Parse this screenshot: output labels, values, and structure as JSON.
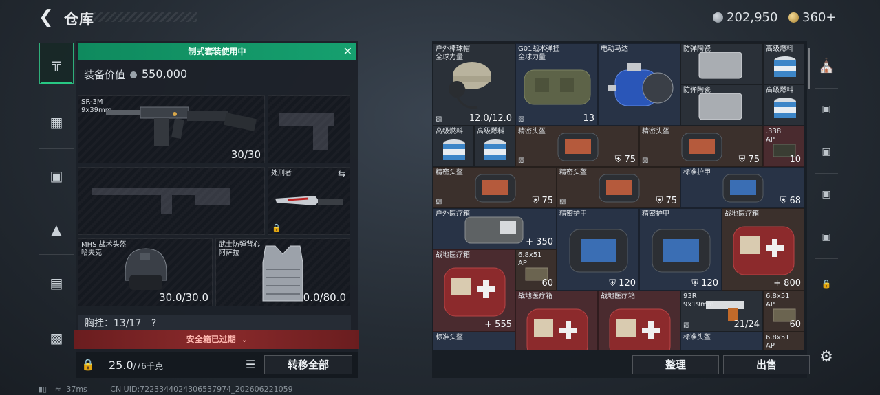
{
  "header": {
    "title": "仓库",
    "silver": "202,950",
    "gold": "360+"
  },
  "loadout": {
    "banner": "制式套装使用中",
    "value_label": "装备价值",
    "value": "550,000",
    "primary": {
      "name": "SR-3M",
      "sub": "9x39mm",
      "count": "30/30"
    },
    "melee": {
      "name": "处刑者"
    },
    "helmet": {
      "name": "MHS 战术头盔",
      "sub": "哈夫克",
      "count": "30.0/30.0"
    },
    "armor": {
      "name": "武士防弹背心",
      "sub": "阿萨拉",
      "count": "80.0/80.0"
    },
    "chest": "胸挂：13/17",
    "chest_help": "?",
    "expired": "安全箱已过期",
    "weight": "25.0",
    "weight_max": "/76千克",
    "transfer_all": "转移全部"
  },
  "storage": {
    "items": [
      {
        "name": "户外棒球帽",
        "sub": "全球力量",
        "count": "12.0/12.0"
      },
      {
        "name": "G01战术弹挂",
        "sub": "全球力量",
        "count": "13"
      },
      {
        "name": "电动马达"
      },
      {
        "name": "防弹陶瓷"
      },
      {
        "name": "高级燃料"
      },
      {
        "name": "防弹陶瓷"
      },
      {
        "name": "高级燃料"
      },
      {
        "name": "高级燃料"
      },
      {
        "name": "高级燃料"
      },
      {
        "name": "精密头盔",
        "count": "75"
      },
      {
        "name": "精密头盔",
        "count": "75"
      },
      {
        "name": ".338",
        "sub": "AP",
        "count": "10"
      },
      {
        "name": "精密头盔",
        "count": "75"
      },
      {
        "name": "精密头盔",
        "count": "75"
      },
      {
        "name": "标准护甲",
        "count": "68"
      },
      {
        "name": "户外医疗箱",
        "count": "+ 350"
      },
      {
        "name": "精密护甲",
        "count": "120"
      },
      {
        "name": "精密护甲",
        "count": "120"
      },
      {
        "name": "战地医疗箱",
        "count": "+ 800"
      },
      {
        "name": "战地医疗箱",
        "count": "+ 555"
      },
      {
        "name": "6.8x51",
        "sub": "AP",
        "count": "60"
      },
      {
        "name": "战地医疗箱"
      },
      {
        "name": "战地医疗箱"
      },
      {
        "name": "93R",
        "sub": "9x19mm",
        "count": "21/24"
      },
      {
        "name": "6.8x51",
        "sub": "AP",
        "count": "60"
      },
      {
        "name": "标准头盔"
      },
      {
        "name": "标准头盔"
      },
      {
        "name": "6.8x51",
        "sub": "AP"
      }
    ],
    "sort_label": "整理",
    "sell_label": "出售"
  },
  "status": {
    "ping": "37ms",
    "uid": "CN UID:7223344024306537974_202606221059"
  },
  "colors": {
    "accent_green": "#16a06f",
    "expired_red": "#8a2a2b",
    "cell_blue": "#283346",
    "cell_brown": "#3b302c",
    "cell_red": "#4a2b2f"
  }
}
